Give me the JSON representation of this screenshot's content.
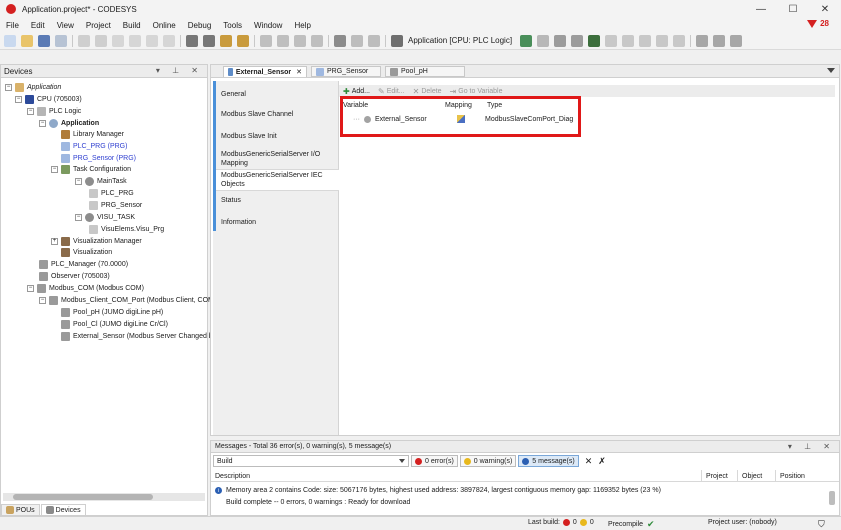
{
  "window": {
    "title": "Application.project* - CODESYS",
    "controls": [
      "—",
      "☐",
      "✕"
    ]
  },
  "menu": [
    "File",
    "Edit",
    "View",
    "Project",
    "Build",
    "Online",
    "Debug",
    "Tools",
    "Window",
    "Help"
  ],
  "notifications": {
    "count": "28"
  },
  "toolbar": {
    "active_app": "Application [CPU: PLC Logic]"
  },
  "devices": {
    "header": "Devices",
    "tree": [
      {
        "label": "Application",
        "italic": true
      },
      {
        "label": "CPU (705003)"
      },
      {
        "label": "PLC Logic"
      },
      {
        "label": "Application",
        "bold": true
      },
      {
        "label": "Library Manager"
      },
      {
        "label": "PLC_PRG (PRG)",
        "blue": true
      },
      {
        "label": "PRG_Sensor (PRG)",
        "blue": true
      },
      {
        "label": "Task Configuration"
      },
      {
        "label": "MainTask"
      },
      {
        "label": "PLC_PRG"
      },
      {
        "label": "PRG_Sensor"
      },
      {
        "label": "VISU_TASK"
      },
      {
        "label": "VisuElems.Visu_Prg"
      },
      {
        "label": "Visualization Manager"
      },
      {
        "label": "Visualization"
      },
      {
        "label": "PLC_Manager (70.0000)"
      },
      {
        "label": "Observer (705003)"
      },
      {
        "label": "Modbus_COM (Modbus COM)"
      },
      {
        "label": "Modbus_Client_COM_Port (Modbus Client, COM Port)"
      },
      {
        "label": "Pool_pH (JUMO digiLine pH)"
      },
      {
        "label": "Pool_Cl (JUMO digiLine Cr/Cl)"
      },
      {
        "label": "External_Sensor (Modbus Server Changed by"
      }
    ],
    "bottom_tabs": [
      "POUs",
      "Devices"
    ]
  },
  "editor": {
    "tabs": [
      "External_Sensor",
      "PRG_Sensor",
      "Pool_pH"
    ],
    "nav": [
      "General",
      "Modbus Slave Channel",
      "Modbus Slave Init",
      "ModbusGenericSerialServer I/O Mapping",
      "ModbusGenericSerialServer IEC Objects",
      "Status",
      "Information"
    ],
    "sub_toolbar": {
      "add": "Add...",
      "edit": "Edit...",
      "delete": "Delete",
      "goto": "Go to Variable"
    },
    "table": {
      "headers": {
        "variable": "Variable",
        "mapping": "Mapping",
        "type": "Type"
      },
      "rows": [
        {
          "variable": "External_Sensor",
          "mapping": "",
          "type": "ModbusSlaveComPort_Diag"
        }
      ]
    }
  },
  "messages": {
    "header": "Messages - Total 36 error(s), 0 warning(s), 5 message(s)",
    "source": "Build",
    "filters": {
      "errors": "0 error(s)",
      "warnings": "0 warning(s)",
      "messages": "5 message(s)"
    },
    "columns": {
      "description": "Description",
      "project": "Project",
      "object": "Object",
      "position": "Position"
    },
    "rows": [
      "Memory area 2 contains  Code: size: 5067176 bytes, highest used address: 3897824, largest contiguous memory gap: 1169352 bytes (23 %)",
      "Build complete -- 0 errors, 0 warnings : Ready for download"
    ]
  },
  "status": {
    "last_build_label": "Last build:",
    "errors": "0",
    "warnings": "0",
    "precompile": "Precompile",
    "project_user": "Project user: (nobody)"
  }
}
